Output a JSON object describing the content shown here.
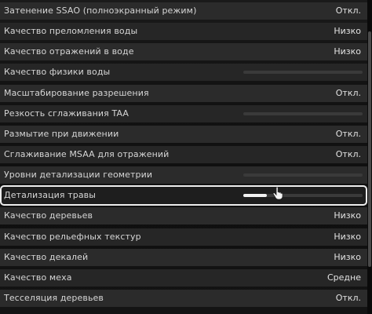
{
  "settings": {
    "rows": [
      {
        "label": "Затенение SSAO (полноэкранный режим)",
        "value": "Откл."
      },
      {
        "label": "Качество преломления воды",
        "value": "Низко"
      },
      {
        "label": "Качество отражений в воде",
        "value": "Низко"
      },
      {
        "label": "Качество физики воды",
        "slider": 0
      },
      {
        "label": "Масштабирование разрешения",
        "value": "Откл."
      },
      {
        "label": "Резкость сглаживания TAA",
        "slider": 0
      },
      {
        "label": "Размытие при движении",
        "value": "Откл."
      },
      {
        "label": "Сглаживание MSAA для отражений",
        "value": "Откл."
      },
      {
        "label": "Уровни детализации геометрии",
        "slider": 0
      },
      {
        "label": "Детализация травы",
        "slider": 0.2
      },
      {
        "label": "Качество деревьев",
        "value": "Низко"
      },
      {
        "label": "Качество рельефных текстур",
        "value": "Низко"
      },
      {
        "label": "Качество декалей",
        "value": "Низко"
      },
      {
        "label": "Качество меха",
        "value": "Средне"
      },
      {
        "label": "Тесселяция деревьев",
        "value": "Откл."
      }
    ]
  },
  "selected_row": "Детализация травы",
  "cursor": {
    "icon": "hand-pointer-icon"
  },
  "colors": {
    "row_bg": "#2b2b2b",
    "selection_border": "#ededed",
    "slider_fill": "#f2f2f2",
    "slider_track": "#3a3a3a"
  }
}
